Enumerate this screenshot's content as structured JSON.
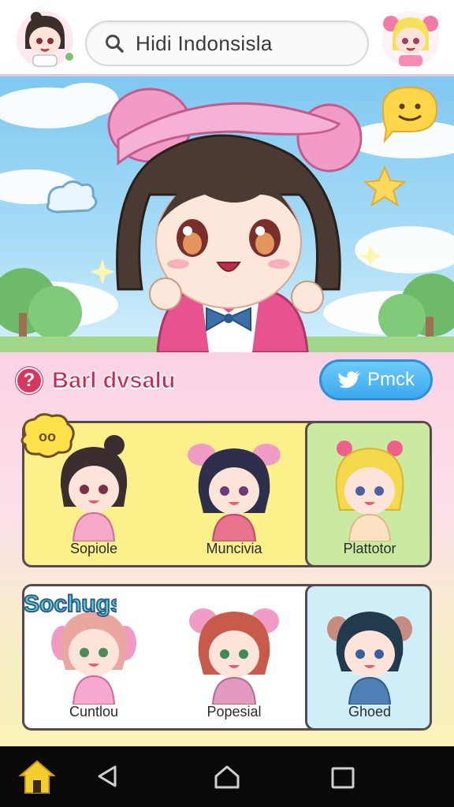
{
  "search": {
    "value": "Hidi Indonsisla"
  },
  "section": {
    "badge": "?",
    "title": "Barl dvsalu"
  },
  "share_button": {
    "label": "Pmck",
    "icon": "bird-icon"
  },
  "stickers": {
    "sticker1": "oo",
    "sticker2": "Sochugs"
  },
  "rows": [
    {
      "cards": [
        {
          "label": "Sopiole",
          "hair": "#3a2f2e",
          "dress": "#f5a8c8",
          "highlight": false
        },
        {
          "label": "Muncivia",
          "hair": "#2d2f4d",
          "dress": "#e9728f",
          "highlight": false
        },
        {
          "label": "Plattotor",
          "hair": "#f4d94e",
          "dress": "#fde2c2",
          "highlight": true
        }
      ]
    },
    {
      "cards": [
        {
          "label": "Cuntlou",
          "hair": "#e9a7a0",
          "dress": "#f6a9cf",
          "highlight": false
        },
        {
          "label": "Popesial",
          "hair": "#c85a4c",
          "dress": "#e39ac0",
          "highlight": false
        },
        {
          "label": "Ghoed",
          "hair": "#223a4e",
          "dress": "#4e80b5",
          "highlight": true
        }
      ]
    }
  ],
  "colors": {
    "accent": "#c92852",
    "share": "#3ba9ef",
    "nav_bg": "#0a0a0a"
  }
}
